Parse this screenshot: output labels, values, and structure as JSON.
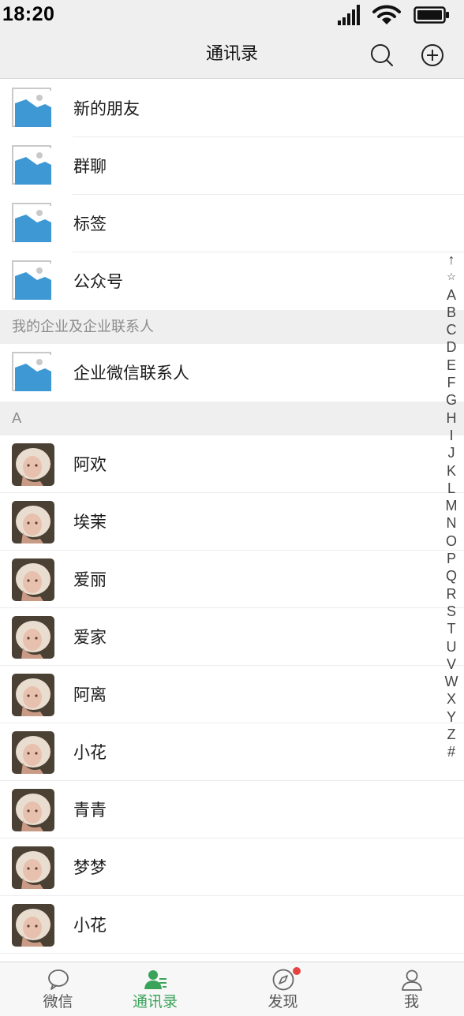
{
  "status_bar": {
    "time": "18:20",
    "icons": [
      "signal-icon",
      "wifi-icon",
      "battery-icon"
    ]
  },
  "header": {
    "title": "通讯录",
    "actions": [
      "search-icon",
      "add-circle-icon"
    ]
  },
  "functions": [
    {
      "label": "新的朋友",
      "icon": "image-placeholder-icon"
    },
    {
      "label": "群聊",
      "icon": "image-placeholder-icon"
    },
    {
      "label": "标签",
      "icon": "image-placeholder-icon"
    },
    {
      "label": "公众号",
      "icon": "image-placeholder-icon"
    }
  ],
  "enterprise_section": {
    "title": "我的企业及企业联系人",
    "item": {
      "label": "企业微信联系人",
      "icon": "image-placeholder-icon"
    }
  },
  "contacts_section": {
    "letter": "A",
    "contacts": [
      {
        "name": "阿欢"
      },
      {
        "name": "埃茉"
      },
      {
        "name": "爱丽"
      },
      {
        "name": "爱家"
      },
      {
        "name": "阿离"
      },
      {
        "name": "小花"
      },
      {
        "name": "青青"
      },
      {
        "name": "梦梦"
      },
      {
        "name": "小花"
      }
    ]
  },
  "index_bar": [
    "↑",
    "☆",
    "A",
    "B",
    "C",
    "D",
    "E",
    "F",
    "G",
    "H",
    "I",
    "J",
    "K",
    "L",
    "M",
    "N",
    "O",
    "P",
    "Q",
    "R",
    "S",
    "T",
    "U",
    "V",
    "W",
    "X",
    "Y",
    "Z",
    "#"
  ],
  "tab_bar": {
    "tabs": [
      {
        "label": "微信",
        "icon": "chat-bubble-icon",
        "active": false,
        "badge": false
      },
      {
        "label": "通讯录",
        "icon": "contacts-icon",
        "active": true,
        "badge": false
      },
      {
        "label": "发现",
        "icon": "compass-icon",
        "active": false,
        "badge": true
      },
      {
        "label": "我",
        "icon": "person-icon",
        "active": false,
        "badge": false
      }
    ]
  },
  "colors": {
    "accent": "#3aa35a",
    "badge": "#e64340",
    "placeholder_blue": "#3d98d4",
    "section_bg": "#efefef"
  }
}
